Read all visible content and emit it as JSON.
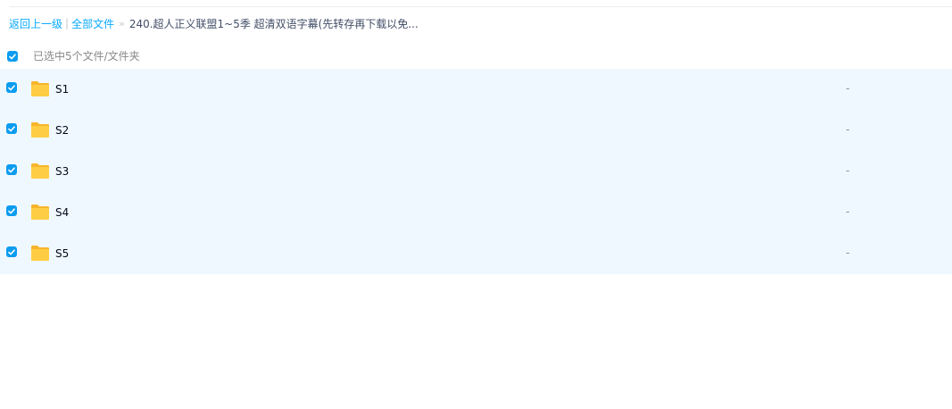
{
  "breadcrumb": {
    "back_label": "返回上一级",
    "separator": "|",
    "root_label": "全部文件",
    "arrow": "»",
    "current_label": "240.超人正义联盟1~5季 超清双语字幕(先转存再下载以免..."
  },
  "selection": {
    "checked": true,
    "summary": "已选中5个文件/文件夹"
  },
  "files": [
    {
      "name": "S1",
      "size": "-",
      "checked": true,
      "icon": "folder-icon"
    },
    {
      "name": "S2",
      "size": "-",
      "checked": true,
      "icon": "folder-icon"
    },
    {
      "name": "S3",
      "size": "-",
      "checked": true,
      "icon": "folder-icon"
    },
    {
      "name": "S4",
      "size": "-",
      "checked": true,
      "icon": "folder-icon"
    },
    {
      "name": "S5",
      "size": "-",
      "checked": true,
      "icon": "folder-icon"
    }
  ],
  "colors": {
    "accent": "#09aaff",
    "checkbox": "#0b9cf0",
    "row_selected_bg": "#f0f8ff",
    "folder": "#ffc83d"
  }
}
